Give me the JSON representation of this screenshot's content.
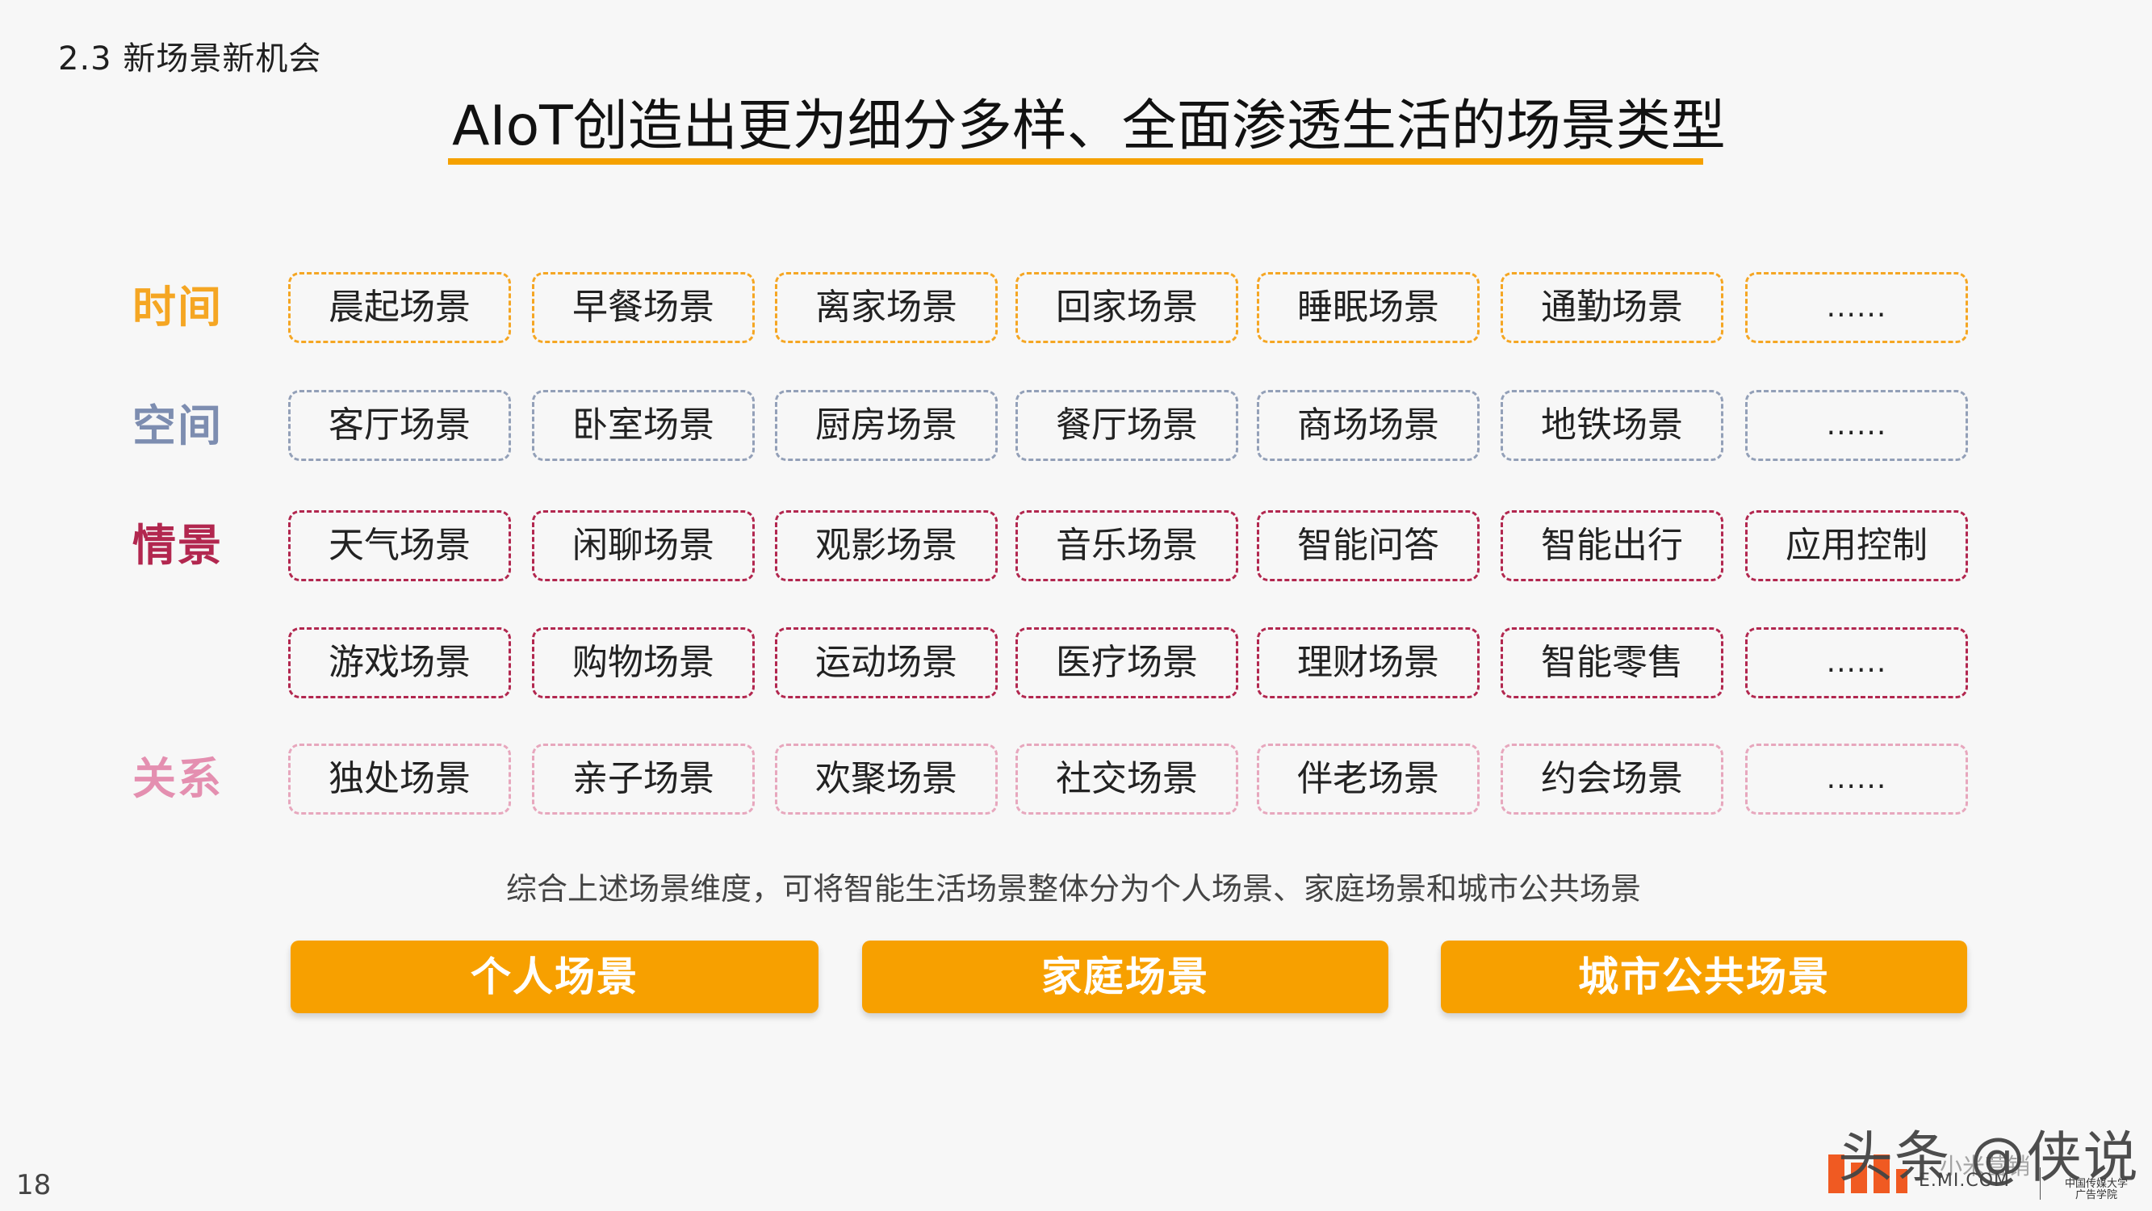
{
  "header": {
    "section": "2.3 新场景新机会",
    "title": "AIoT创造出更为细分多样、全面渗透生活的场景类型"
  },
  "rows": [
    {
      "label": "时间",
      "color": "#f5a623",
      "cells": [
        "晨起场景",
        "早餐场景",
        "离家场景",
        "回家场景",
        "睡眠场景",
        "通勤场景",
        "......"
      ]
    },
    {
      "label": "空间",
      "color": "#7d8db0",
      "cells": [
        "客厅场景",
        "卧室场景",
        "厨房场景",
        "餐厅场景",
        "商场场景",
        "地铁场景",
        "......"
      ]
    },
    {
      "label": "情景",
      "color": "#b2274f",
      "cells": [
        "天气场景",
        "闲聊场景",
        "观影场景",
        "音乐场景",
        "智能问答",
        "智能出行",
        "应用控制"
      ]
    },
    {
      "label": "",
      "color": "#b2274f",
      "cells": [
        "游戏场景",
        "购物场景",
        "运动场景",
        "医疗场景",
        "理财场景",
        "智能零售",
        "......"
      ]
    },
    {
      "label": "关系",
      "color": "#e48fb0",
      "cells": [
        "独处场景",
        "亲子场景",
        "欢聚场景",
        "社交场景",
        "伴老场景",
        "约会场景",
        "......"
      ]
    }
  ],
  "summary": "综合上述场景维度，可将智能生活场景整体分为个人场景、家庭场景和城市公共场景",
  "categories": [
    "个人场景",
    "家庭场景",
    "城市公共场景"
  ],
  "page_number": "18",
  "watermark": {
    "text": "头条 @侠说",
    "sub": "小米营销",
    "site": "E.MI.COM",
    "school": "中国传媒大学 广告学院"
  }
}
